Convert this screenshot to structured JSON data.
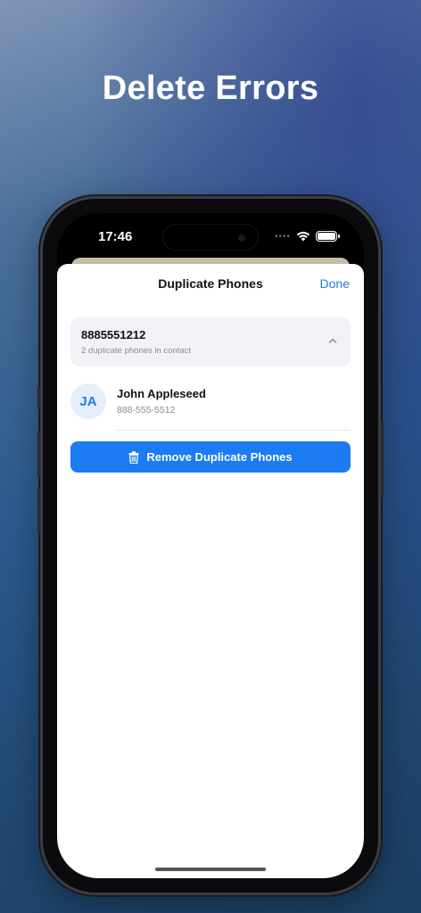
{
  "headline": "Delete Errors",
  "status_bar": {
    "time": "17:46",
    "signal_dots": "••••"
  },
  "sheet": {
    "title": "Duplicate Phones",
    "done_label": "Done"
  },
  "duplicate_group": {
    "number": "8885551212",
    "subtitle": "2 duplicate phones in contact"
  },
  "contact": {
    "initials": "JA",
    "name": "John Appleseed",
    "phone": "888-555-5512"
  },
  "remove_button": {
    "label": "Remove Duplicate Phones"
  },
  "colors": {
    "accent": "#1a7cf0",
    "avatar_bg": "#e4effc",
    "card_bg": "#f2f2f6"
  }
}
